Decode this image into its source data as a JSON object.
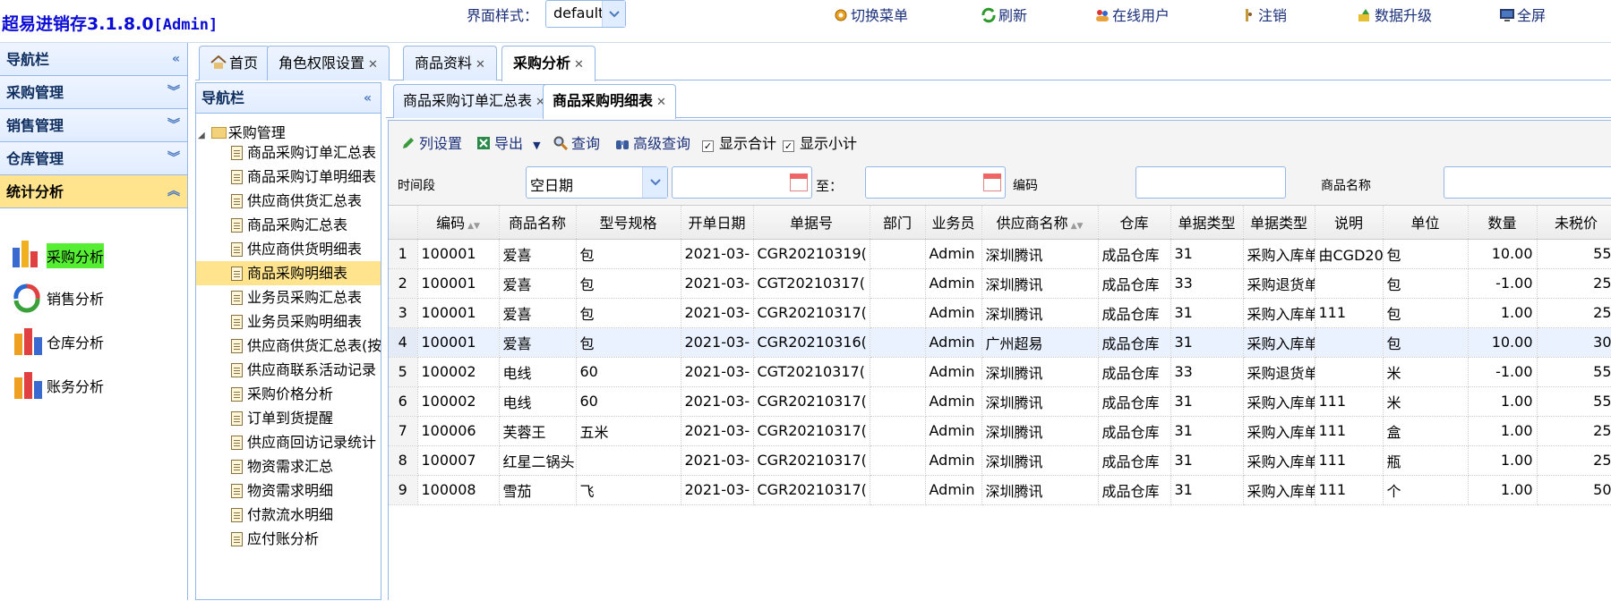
{
  "app": {
    "title": "超易进销存3.1.8.0",
    "role": "[Admin]"
  },
  "theme": {
    "label": "界面样式：",
    "value": "default"
  },
  "topnav": [
    "切换菜单",
    "刷新",
    "在线用户",
    "注销",
    "数据升级",
    "全屏"
  ],
  "west": {
    "items": [
      {
        "label": "导航栏",
        "state": "collapse-left"
      },
      {
        "label": "采购管理",
        "state": "collapse-down"
      },
      {
        "label": "销售管理",
        "state": "collapse-down"
      },
      {
        "label": "仓库管理",
        "state": "collapse-down"
      },
      {
        "label": "统计分析",
        "state": "collapse-up"
      }
    ],
    "stats": [
      "采购分析",
      "销售分析",
      "仓库分析",
      "账务分析"
    ]
  },
  "maintabs": [
    {
      "label": "首页"
    },
    {
      "label": "角色权限设置"
    },
    {
      "label": "商品资料"
    },
    {
      "label": "采购分析"
    }
  ],
  "tree": {
    "header": "导航栏",
    "root": "采购管理",
    "items": [
      "商品采购订单汇总表",
      "商品采购订单明细表",
      "供应商供货汇总表",
      "商品采购汇总表",
      "供应商供货明细表",
      "商品采购明细表",
      "业务员采购汇总表",
      "业务员采购明细表",
      "供应商供货汇总表(按",
      "供应商联系活动记录",
      "采购价格分析",
      "订单到货提醒",
      "供应商回访记录统计",
      "物资需求汇总",
      "物资需求明细",
      "付款流水明细",
      "应付账分析"
    ]
  },
  "subtabs": [
    "商品采购订单汇总表",
    "商品采购明细表"
  ],
  "toolbar": {
    "cols": "列设置",
    "export": "导出",
    "query": "查询",
    "adv": "高级查询",
    "sum": "显示合计",
    "subtotal": "显示小计"
  },
  "filter": {
    "period_label": "时间段",
    "period_value": "空日期",
    "to": "至：",
    "code": "编码",
    "name": "商品名称"
  },
  "columns": [
    "编码",
    "商品名称",
    "型号规格",
    "开单日期",
    "单据号",
    "部门",
    "业务员",
    "供应商名称",
    "仓库",
    "单据类型",
    "单据类型",
    "说明",
    "单位",
    "数量",
    "未税价"
  ],
  "rows": [
    [
      "1",
      "100001",
      "爱喜",
      "包",
      "2021-03-",
      "CGR20210319(",
      "",
      "Admin",
      "深圳腾讯",
      "成品仓库",
      "31",
      "采购入库单",
      "由CGD20",
      "包",
      "10.00",
      "55"
    ],
    [
      "2",
      "100001",
      "爱喜",
      "包",
      "2021-03-",
      "CGT20210317(",
      "",
      "Admin",
      "深圳腾讯",
      "成品仓库",
      "33",
      "采购退货单",
      "",
      "包",
      "-1.00",
      "25"
    ],
    [
      "3",
      "100001",
      "爱喜",
      "包",
      "2021-03-",
      "CGR20210317(",
      "",
      "Admin",
      "深圳腾讯",
      "成品仓库",
      "31",
      "采购入库单",
      "111",
      "包",
      "1.00",
      "25"
    ],
    [
      "4",
      "100001",
      "爱喜",
      "包",
      "2021-03-",
      "CGR20210316(",
      "",
      "Admin",
      "广州超易",
      "成品仓库",
      "31",
      "采购入库单",
      "",
      "包",
      "10.00",
      "30"
    ],
    [
      "5",
      "100002",
      "电线",
      "60",
      "2021-03-",
      "CGT20210317(",
      "",
      "Admin",
      "深圳腾讯",
      "成品仓库",
      "33",
      "采购退货单",
      "",
      "米",
      "-1.00",
      "55"
    ],
    [
      "6",
      "100002",
      "电线",
      "60",
      "2021-03-",
      "CGR20210317(",
      "",
      "Admin",
      "深圳腾讯",
      "成品仓库",
      "31",
      "采购入库单",
      "111",
      "米",
      "1.00",
      "55"
    ],
    [
      "7",
      "100006",
      "芙蓉王",
      "五米",
      "2021-03-",
      "CGR20210317(",
      "",
      "Admin",
      "深圳腾讯",
      "成品仓库",
      "31",
      "采购入库单",
      "111",
      "盒",
      "1.00",
      "25"
    ],
    [
      "8",
      "100007",
      "红星二锅头",
      "",
      "2021-03-",
      "CGR20210317(",
      "",
      "Admin",
      "深圳腾讯",
      "成品仓库",
      "31",
      "采购入库单",
      "111",
      "瓶",
      "1.00",
      "25"
    ],
    [
      "9",
      "100008",
      "雪茄",
      "飞",
      "2021-03-",
      "CGR20210317(",
      "",
      "Admin",
      "深圳腾讯",
      "成品仓库",
      "31",
      "采购入库单",
      "111",
      "个",
      "1.00",
      "50"
    ]
  ],
  "highlight_row": 4
}
